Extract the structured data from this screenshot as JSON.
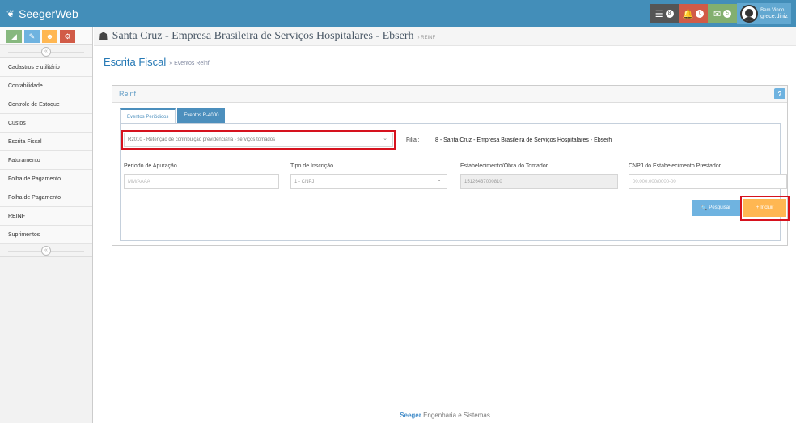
{
  "app": {
    "brand": "SeegerWeb"
  },
  "header": {
    "counters": {
      "tasks": "8",
      "notifications": "0",
      "messages": "5"
    },
    "user": {
      "greeting": "Bem Vindo,",
      "name": "grece.diniz"
    }
  },
  "sidebar": {
    "collapse_glyph": "«",
    "expand_glyph": "«",
    "items": [
      {
        "label": "Cadastros e utilitário"
      },
      {
        "label": "Contabilidade"
      },
      {
        "label": "Controle de Estoque"
      },
      {
        "label": "Custos"
      },
      {
        "label": "Escrita Fiscal"
      },
      {
        "label": "Faturamento"
      },
      {
        "label": "Folha de Pagamento"
      },
      {
        "label": "Folha de Pagamento"
      },
      {
        "label": "REINF"
      },
      {
        "label": "Suprimentos"
      }
    ]
  },
  "breadcrumb": {
    "company": "Santa Cruz - Empresa Brasileira de Serviços Hospitalares - Ebserh",
    "module": "› REINF"
  },
  "page": {
    "title": "Escrita Fiscal",
    "subtitle": "» Eventos Reinf"
  },
  "widget": {
    "title": "Reinf",
    "help": "?",
    "tabs": [
      {
        "label": "Eventos Periódicos",
        "active": true
      },
      {
        "label": "Eventos R-4000",
        "active": false
      }
    ]
  },
  "form": {
    "event_select": "R2010 - Retenção de contribuição previdenciária - serviços tomados",
    "filial_label": "Filial:",
    "filial_value": "8 - Santa Cruz - Empresa Brasileira de Serviços Hospitalares - Ebserh",
    "periodo_label": "Período de Apuração",
    "periodo_placeholder": "MM/AAAA",
    "tipo_label": "Tipo de Inscrição",
    "tipo_value": "1 - CNPJ",
    "estabelecimento_label": "Estabelecimento/Obra do Tomador",
    "estabelecimento_value": "15126437000810",
    "cnpj_label": "CNPJ do Estabelecimento Prestador",
    "cnpj_placeholder": "00.000.000/0000-00",
    "pesquisar_label": "Pesquisar",
    "incluir_label": "Incluir"
  },
  "footer": {
    "brand": "Seeger",
    "text": " Engenharia e Sistemas"
  },
  "colors": {
    "topbar": "#438eb9",
    "accent": "#4c8fbd",
    "highlight": "#d6121e",
    "orange": "#ffb752"
  }
}
